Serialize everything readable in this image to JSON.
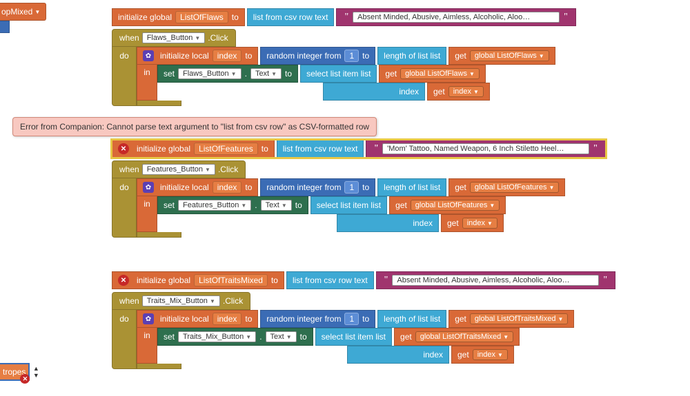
{
  "partials": {
    "topMixed": "opMixed",
    "tropes": "tropes"
  },
  "flaws": {
    "init": {
      "label": "initialize global",
      "varName": "ListOfFlaws",
      "to": "to",
      "csv": "list from csv row  text",
      "value": " Absent Minded, Abusive, Aimless, Alcoholic, Aloo…"
    },
    "when": {
      "when": "when",
      "component": "Flaws_Button",
      "event": ".Click",
      "do": "do",
      "localInit": "initialize local",
      "indexVar": "index",
      "to": "to",
      "randFrom": "random integer from",
      "one": "1",
      "toLbl": "to",
      "lenList": "length of list  list",
      "get": "get",
      "globalVar": "global ListOfFlaws",
      "in": "in",
      "set": "set",
      "setComp": "Flaws_Button",
      "dot": ".",
      "textProp": "Text",
      "setTo": "to",
      "selectItem": "select list item  list",
      "indexLbl": "index"
    }
  },
  "features": {
    "init": {
      "label": "initialize global",
      "varName": "ListOfFeatures",
      "to": "to",
      "csv": "list from csv row  text",
      "value": " 'Mom' Tattoo, Named Weapon, 6 Inch Stiletto Heel…"
    },
    "when": {
      "when": "when",
      "component": "Features_Button",
      "event": ".Click",
      "do": "do",
      "localInit": "initialize local",
      "indexVar": "index",
      "to": "to",
      "randFrom": "random integer from",
      "one": "1",
      "toLbl": "to",
      "lenList": "length of list  list",
      "get": "get",
      "globalVar": "global ListOfFeatures",
      "in": "in",
      "set": "set",
      "setComp": "Features_Button",
      "dot": ".",
      "textProp": "Text",
      "setTo": "to",
      "selectItem": "select list item  list",
      "indexLbl": "index"
    }
  },
  "traits": {
    "init": {
      "label": "initialize global",
      "varName": "ListOfTraitsMixed",
      "to": "to",
      "csv": "list from csv row  text",
      "value": " Absent Minded, Abusive, Aimless, Alcoholic, Aloo…"
    },
    "when": {
      "when": "when",
      "component": "Traits_Mix_Button",
      "event": ".Click",
      "do": "do",
      "localInit": "initialize local",
      "indexVar": "index",
      "to": "to",
      "randFrom": "random integer from",
      "one": "1",
      "toLbl": "to",
      "lenList": "length of list  list",
      "get": "get",
      "globalVar": "global ListOfTraitsMixed",
      "in": "in",
      "set": "set",
      "setComp": "Traits_Mix_Button",
      "dot": ".",
      "textProp": "Text",
      "setTo": "to",
      "selectItem": "select list item  list",
      "indexLbl": "index"
    }
  },
  "error": {
    "message": "Error from Companion: Cannot parse text argument to \"list from csv row\" as CSV-formatted row"
  }
}
